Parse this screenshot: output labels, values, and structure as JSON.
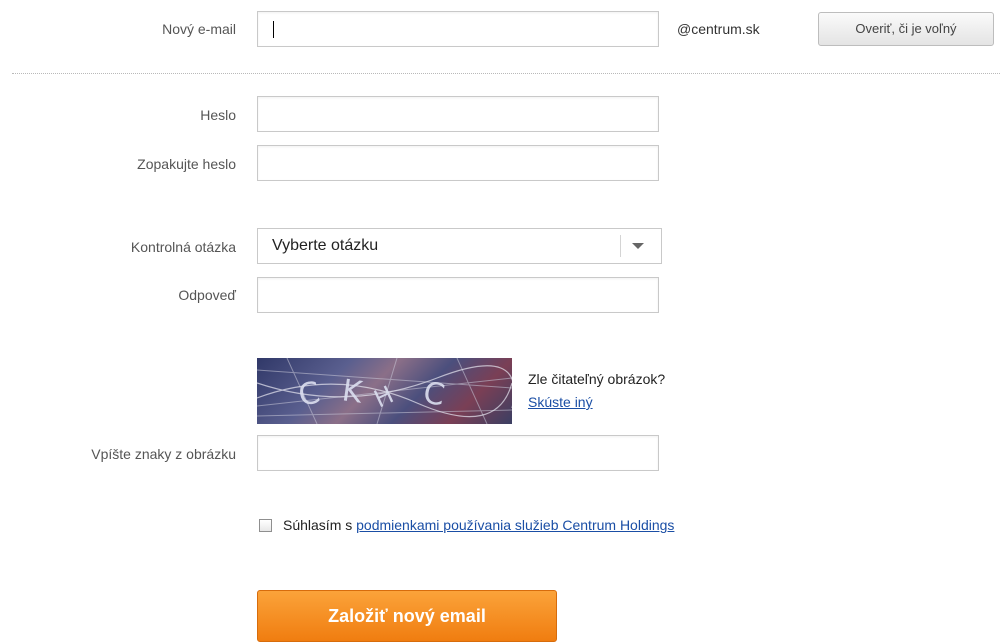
{
  "form": {
    "email_label": "Nový e-mail",
    "email_value": "",
    "domain": "@centrum.sk",
    "check_button": "Overiť, či je voľný",
    "password_label": "Heslo",
    "password_repeat_label": "Zopakujte heslo",
    "question_label": "Kontrolná otázka",
    "question_selected": "Vyberte otázku",
    "answer_label": "Odpoveď",
    "captcha": {
      "unreadable_text": "Zle čitateľný obrázok?",
      "try_another": "Skúste iný",
      "image_letters": "CKHC"
    },
    "captcha_input_label": "Vpíšte znaky z obrázku",
    "agree_text": "Súhlasím s ",
    "agree_link": "podmienkami používania služieb Centrum Holdings",
    "submit_label": "Založiť nový email"
  }
}
